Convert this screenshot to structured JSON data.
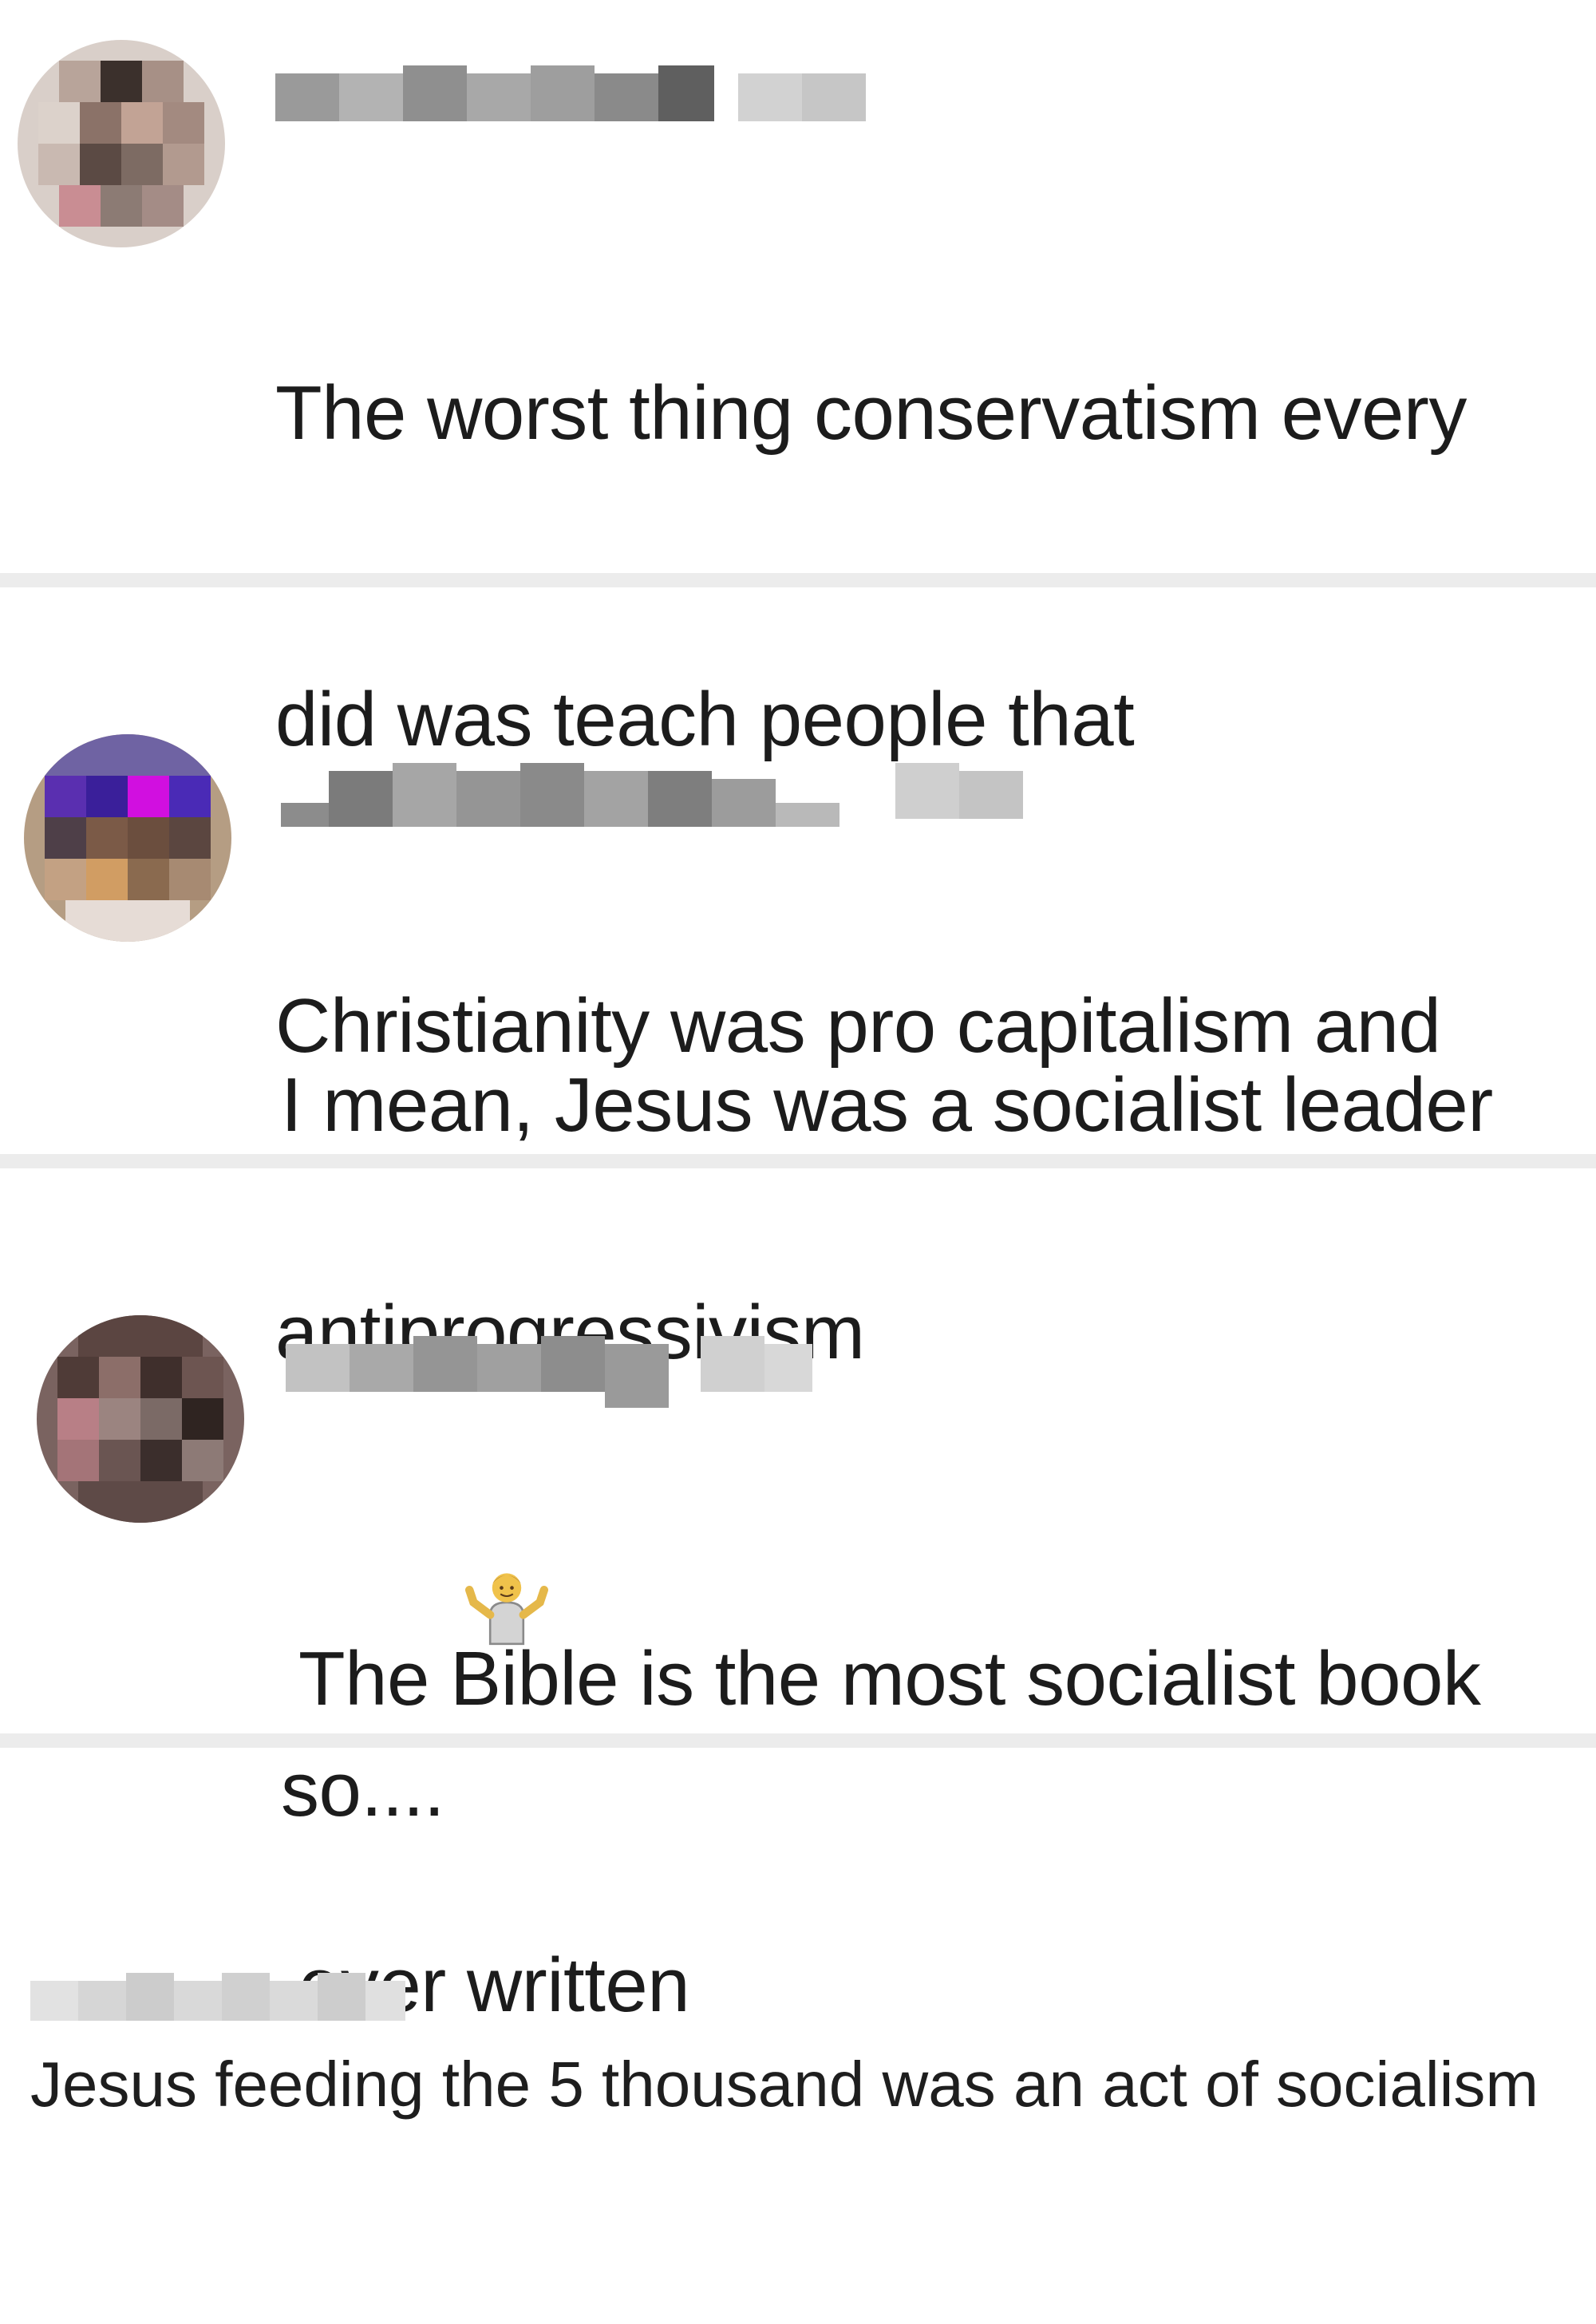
{
  "comments": [
    {
      "username": "",
      "text": "The worst thing conservatism every did was teach people that Christianity was pro capitalism and antiprogressivism",
      "lines": [
        "The worst thing conservatism every",
        "did was teach people that",
        "Christianity was pro capitalism and",
        "antiprogressivism"
      ]
    },
    {
      "username": "",
      "text": "I mean, Jesus was a socialist leader so.... 🤷‍♂️",
      "lines": [
        "I mean, Jesus was a socialist leader",
        "so.... "
      ],
      "emoji": "shrug-emoji"
    },
    {
      "username": "",
      "text": "The Bible is the most socialist book ever written",
      "lines": [
        "The Bible is the most socialist book",
        "ever written"
      ]
    },
    {
      "username": "",
      "text": "Jesus feeding the 5 thousand was an act of socialism"
    }
  ],
  "colors": {
    "text": "#1c1c1c",
    "divider": "#ececec",
    "background": "#ffffff"
  }
}
